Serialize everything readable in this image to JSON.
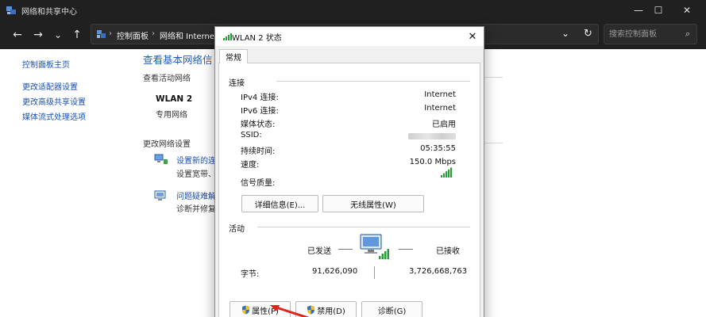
{
  "window": {
    "title": "网络和共享中心",
    "minimize_glyph": "—",
    "maximize_glyph": "☐",
    "close_glyph": "✕"
  },
  "toolbar": {
    "back_glyph": "←",
    "forward_glyph": "→",
    "recent_glyph": "⌄",
    "up_glyph": "↑",
    "breadcrumb": [
      "控制面板",
      "网络和 Internet"
    ],
    "breadcrumb_sep": "›",
    "dropdown_glyph": "⌄",
    "refresh_glyph": "↻",
    "search_placeholder": "搜索控制面板",
    "search_glyph": "⌕"
  },
  "sidebar": {
    "items": [
      {
        "label": "控制面板主页"
      },
      {
        "label": "更改适配器设置"
      },
      {
        "label": "更改高级共享设置"
      },
      {
        "label": "媒体流式处理选项"
      }
    ]
  },
  "main": {
    "title": "查看基本网络信",
    "active_networks_heading": "查看活动网络",
    "network_name": "WLAN 2",
    "network_type": "专用网络",
    "change_settings_heading": "更改网络设置",
    "tasks": [
      {
        "link": "设置新的连",
        "desc": "设置宽带、"
      },
      {
        "link": "问题疑难解",
        "desc": "诊断并修复"
      }
    ]
  },
  "dialog": {
    "title": "WLAN 2 状态",
    "close_glyph": "✕",
    "tab": "常规",
    "connection_heading": "连接",
    "rows": [
      {
        "label": "IPv4 连接:",
        "value": "Internet"
      },
      {
        "label": "IPv6 连接:",
        "value": "Internet"
      },
      {
        "label": "媒体状态:",
        "value": "已启用"
      },
      {
        "label": "SSID:",
        "value": ""
      },
      {
        "label": "持续时间:",
        "value": "05:35:55"
      },
      {
        "label": "速度:",
        "value": "150.0 Mbps"
      }
    ],
    "signal_label": "信号质量:",
    "signal_bars": 5,
    "details_button": "详细信息(E)...",
    "wireless_button": "无线属性(W)",
    "activity_heading": "活动",
    "sent_label": "已发送",
    "received_label": "已接收",
    "bytes_label": "字节:",
    "bytes_sent": "91,626,090",
    "bytes_received": "3,726,668,763",
    "properties_button": "属性(P)",
    "disable_button": "禁用(D)",
    "diagnose_button": "诊断(G)",
    "accent_color": "#2a9d3a"
  }
}
